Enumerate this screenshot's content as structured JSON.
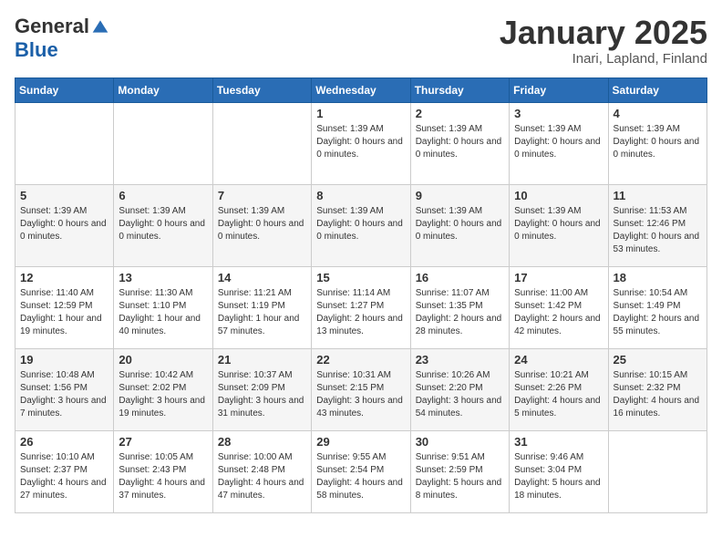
{
  "header": {
    "logo_general": "General",
    "logo_blue": "Blue",
    "title": "January 2025",
    "subtitle": "Inari, Lapland, Finland"
  },
  "weekdays": [
    "Sunday",
    "Monday",
    "Tuesday",
    "Wednesday",
    "Thursday",
    "Friday",
    "Saturday"
  ],
  "weeks": [
    [
      {
        "day": "",
        "info": ""
      },
      {
        "day": "",
        "info": ""
      },
      {
        "day": "",
        "info": ""
      },
      {
        "day": "1",
        "info": "Sunset: 1:39 AM\nDaylight: 0 hours and 0 minutes."
      },
      {
        "day": "2",
        "info": "Sunset: 1:39 AM\nDaylight: 0 hours and 0 minutes."
      },
      {
        "day": "3",
        "info": "Sunset: 1:39 AM\nDaylight: 0 hours and 0 minutes."
      },
      {
        "day": "4",
        "info": "Sunset: 1:39 AM\nDaylight: 0 hours and 0 minutes."
      }
    ],
    [
      {
        "day": "5",
        "info": "Sunset: 1:39 AM\nDaylight: 0 hours and 0 minutes."
      },
      {
        "day": "6",
        "info": "Sunset: 1:39 AM\nDaylight: 0 hours and 0 minutes."
      },
      {
        "day": "7",
        "info": "Sunset: 1:39 AM\nDaylight: 0 hours and 0 minutes."
      },
      {
        "day": "8",
        "info": "Sunset: 1:39 AM\nDaylight: 0 hours and 0 minutes."
      },
      {
        "day": "9",
        "info": "Sunset: 1:39 AM\nDaylight: 0 hours and 0 minutes."
      },
      {
        "day": "10",
        "info": "Sunset: 1:39 AM\nDaylight: 0 hours and 0 minutes."
      },
      {
        "day": "11",
        "info": "Sunrise: 11:53 AM\nSunset: 12:46 PM\nDaylight: 0 hours and 53 minutes."
      }
    ],
    [
      {
        "day": "12",
        "info": "Sunrise: 11:40 AM\nSunset: 12:59 PM\nDaylight: 1 hour and 19 minutes."
      },
      {
        "day": "13",
        "info": "Sunrise: 11:30 AM\nSunset: 1:10 PM\nDaylight: 1 hour and 40 minutes."
      },
      {
        "day": "14",
        "info": "Sunrise: 11:21 AM\nSunset: 1:19 PM\nDaylight: 1 hour and 57 minutes."
      },
      {
        "day": "15",
        "info": "Sunrise: 11:14 AM\nSunset: 1:27 PM\nDaylight: 2 hours and 13 minutes."
      },
      {
        "day": "16",
        "info": "Sunrise: 11:07 AM\nSunset: 1:35 PM\nDaylight: 2 hours and 28 minutes."
      },
      {
        "day": "17",
        "info": "Sunrise: 11:00 AM\nSunset: 1:42 PM\nDaylight: 2 hours and 42 minutes."
      },
      {
        "day": "18",
        "info": "Sunrise: 10:54 AM\nSunset: 1:49 PM\nDaylight: 2 hours and 55 minutes."
      }
    ],
    [
      {
        "day": "19",
        "info": "Sunrise: 10:48 AM\nSunset: 1:56 PM\nDaylight: 3 hours and 7 minutes."
      },
      {
        "day": "20",
        "info": "Sunrise: 10:42 AM\nSunset: 2:02 PM\nDaylight: 3 hours and 19 minutes."
      },
      {
        "day": "21",
        "info": "Sunrise: 10:37 AM\nSunset: 2:09 PM\nDaylight: 3 hours and 31 minutes."
      },
      {
        "day": "22",
        "info": "Sunrise: 10:31 AM\nSunset: 2:15 PM\nDaylight: 3 hours and 43 minutes."
      },
      {
        "day": "23",
        "info": "Sunrise: 10:26 AM\nSunset: 2:20 PM\nDaylight: 3 hours and 54 minutes."
      },
      {
        "day": "24",
        "info": "Sunrise: 10:21 AM\nSunset: 2:26 PM\nDaylight: 4 hours and 5 minutes."
      },
      {
        "day": "25",
        "info": "Sunrise: 10:15 AM\nSunset: 2:32 PM\nDaylight: 4 hours and 16 minutes."
      }
    ],
    [
      {
        "day": "26",
        "info": "Sunrise: 10:10 AM\nSunset: 2:37 PM\nDaylight: 4 hours and 27 minutes."
      },
      {
        "day": "27",
        "info": "Sunrise: 10:05 AM\nSunset: 2:43 PM\nDaylight: 4 hours and 37 minutes."
      },
      {
        "day": "28",
        "info": "Sunrise: 10:00 AM\nSunset: 2:48 PM\nDaylight: 4 hours and 47 minutes."
      },
      {
        "day": "29",
        "info": "Sunrise: 9:55 AM\nSunset: 2:54 PM\nDaylight: 4 hours and 58 minutes."
      },
      {
        "day": "30",
        "info": "Sunrise: 9:51 AM\nSunset: 2:59 PM\nDaylight: 5 hours and 8 minutes."
      },
      {
        "day": "31",
        "info": "Sunrise: 9:46 AM\nSunset: 3:04 PM\nDaylight: 5 hours and 18 minutes."
      },
      {
        "day": "",
        "info": ""
      }
    ]
  ]
}
